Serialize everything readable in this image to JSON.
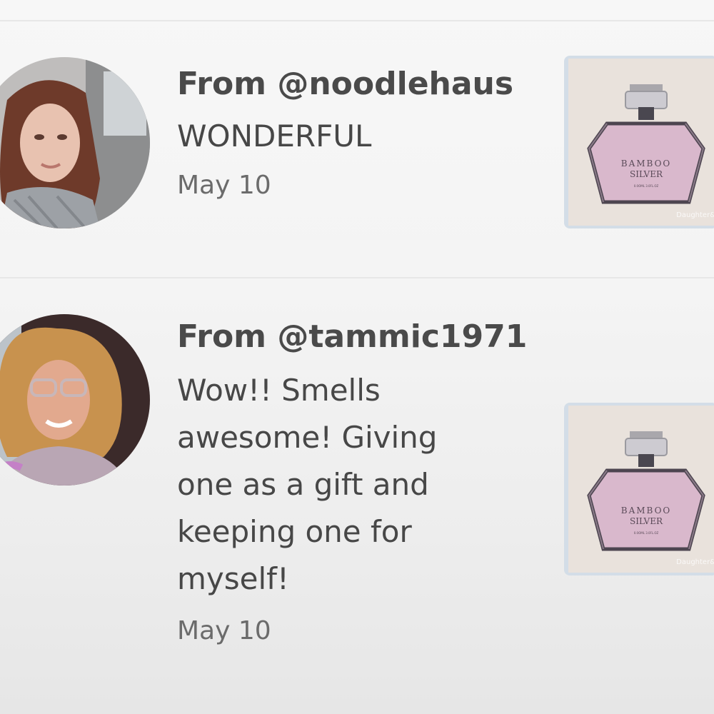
{
  "reviews": [
    {
      "from": "From @noodlehaus",
      "text": "WONDERFUL",
      "date": "May 10",
      "product": {
        "brand_line1": "BAMBOO",
        "brand_line2": "SILVER",
        "volume": "0.0OML 3.0FL.OZ",
        "watermark": "Daughter&"
      }
    },
    {
      "from": "From @tammic1971",
      "text_lines": [
        "Wow!! Smells",
        "awesome! Giving",
        "one as a gift and",
        "keeping one for",
        "myself!"
      ],
      "date": "May 10",
      "product": {
        "brand_line1": "BAMBOO",
        "brand_line2": "SILVER",
        "volume": "0.0OML 3.0FL.OZ",
        "watermark": "Daughter&"
      }
    }
  ],
  "colors": {
    "background": "#f5f5f5",
    "divider": "#e7e7e7",
    "text": "#454545",
    "date": "#6b6b6b",
    "bottle_pink": "#d9b8cc"
  }
}
